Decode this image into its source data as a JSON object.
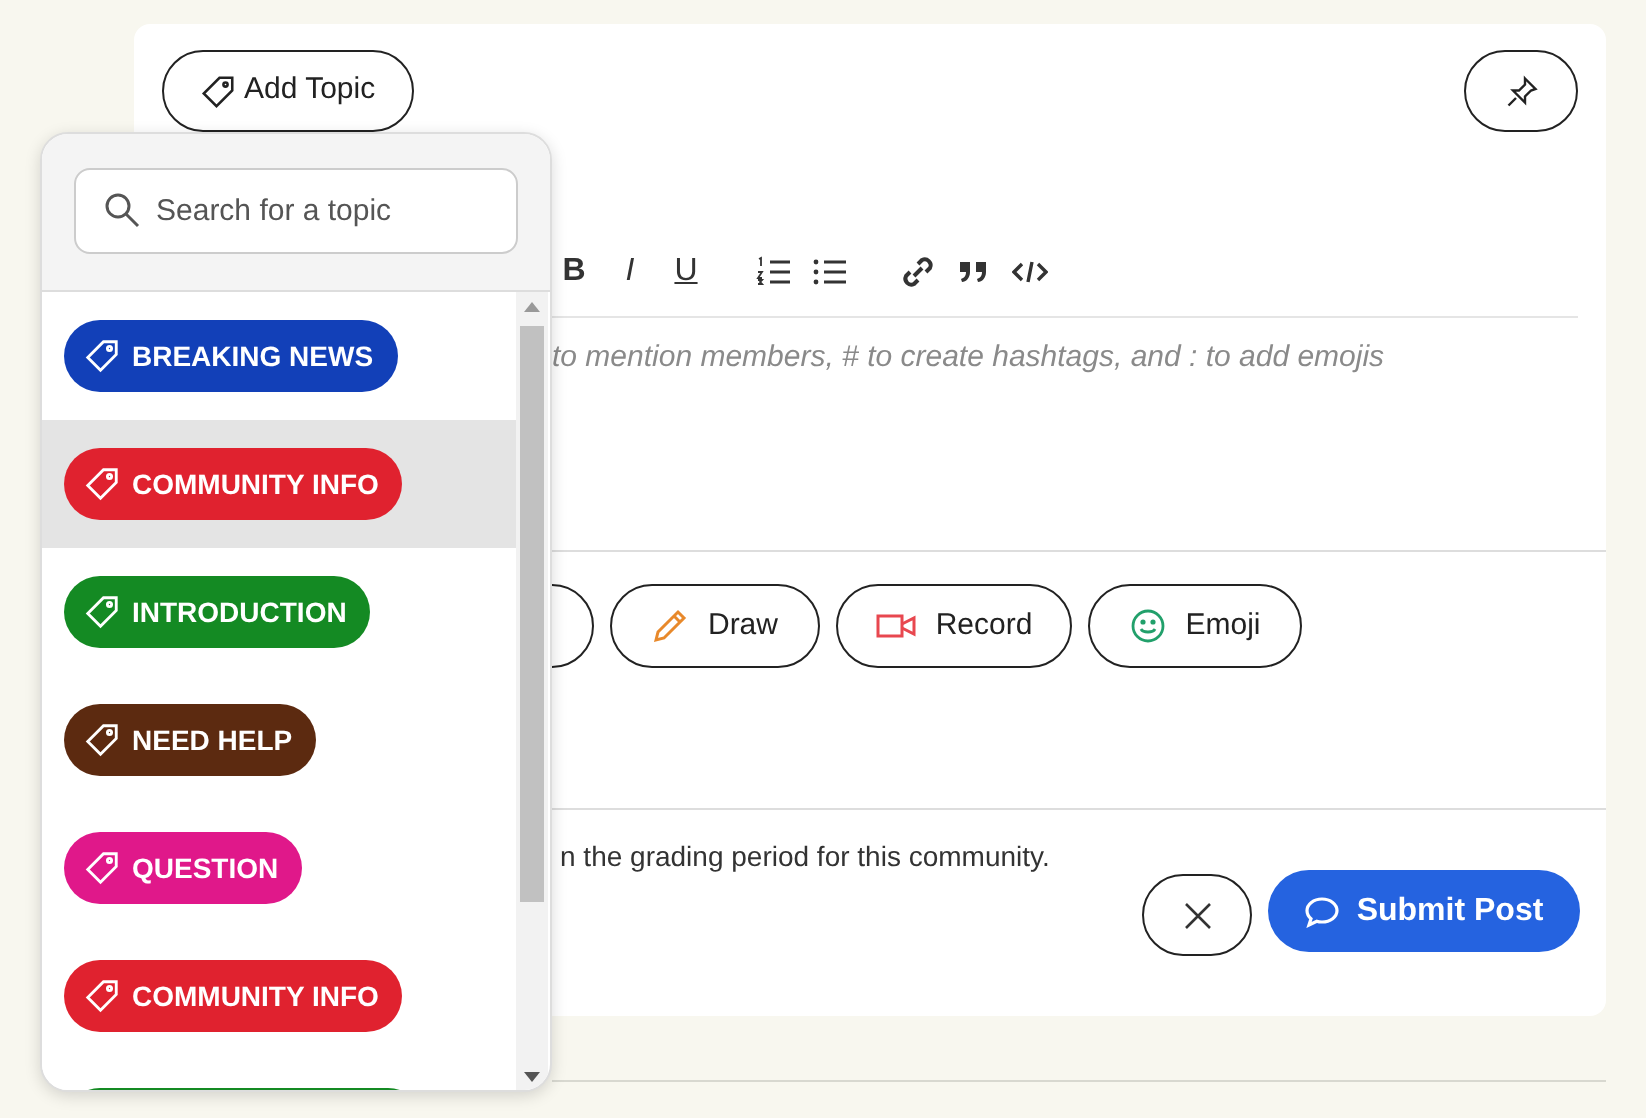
{
  "add_topic_button": {
    "label": "Add Topic"
  },
  "topic_popover": {
    "search": {
      "placeholder": "Search for a topic"
    },
    "topics": [
      {
        "label": "BREAKING NEWS",
        "color": "#1240b8",
        "selected": false
      },
      {
        "label": "COMMUNITY INFO",
        "color": "#e0222f",
        "selected": true
      },
      {
        "label": "INTRODUCTION",
        "color": "#148a23",
        "selected": false
      },
      {
        "label": "NEED HELP",
        "color": "#5c2a10",
        "selected": false
      },
      {
        "label": "QUESTION",
        "color": "#e0188a",
        "selected": false
      },
      {
        "label": "COMMUNITY INFO",
        "color": "#e0222f",
        "selected": false
      },
      {
        "color": "#148a23",
        "selected": false
      }
    ]
  },
  "format_buttons": [
    "B",
    "I",
    "U"
  ],
  "editor": {
    "placeholder": "to mention members, # to create hashtags, and : to add emojis"
  },
  "media_buttons": [
    {
      "kind": "draw",
      "label": "Draw"
    },
    {
      "kind": "record",
      "label": "Record"
    },
    {
      "kind": "emoji",
      "label": "Emoji"
    }
  ],
  "notice": "n the grading period for this community.",
  "submit_button": {
    "label": "Submit Post"
  }
}
